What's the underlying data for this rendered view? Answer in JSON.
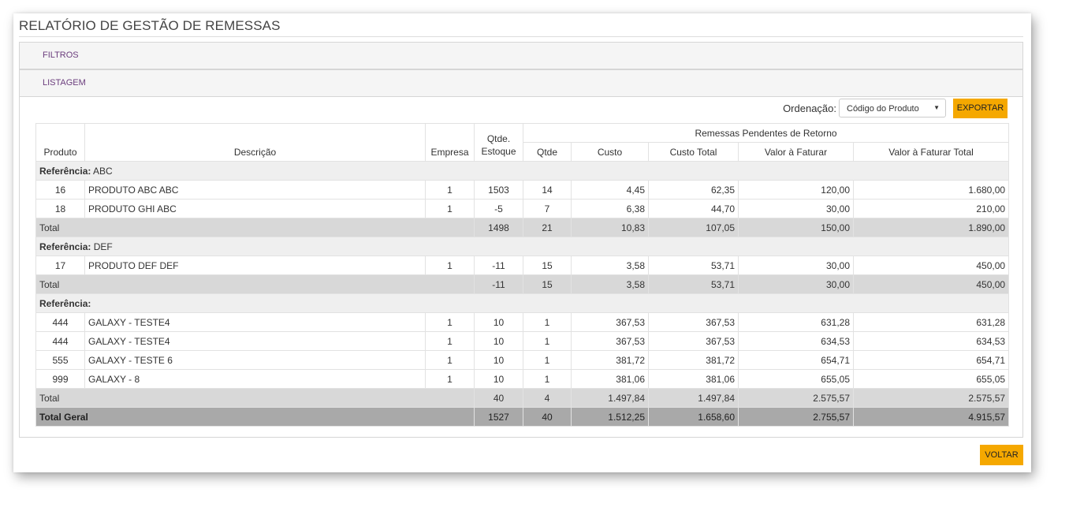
{
  "page": {
    "title": "RELATÓRIO DE GESTÃO DE REMESSAS",
    "filtros_label": "FILTROS",
    "listagem_label": "LISTAGEM",
    "ordenacao_label": "Ordenação:",
    "ordenacao_value": "Código do Produto",
    "export_label": "EXPORTAR",
    "voltar_label": "VOLTAR"
  },
  "table": {
    "headers": {
      "produto": "Produto",
      "descricao": "Descrição",
      "empresa": "Empresa",
      "qtde_estoque_1": "Qtde.",
      "qtde_estoque_2": "Estoque",
      "group": "Remessas Pendentes de Retorno",
      "qtde": "Qtde",
      "custo": "Custo",
      "custo_total": "Custo Total",
      "valor_faturar": "Valor à Faturar",
      "valor_faturar_total": "Valor à Faturar Total"
    },
    "ref_prefix": "Referência:",
    "total_label": "Total",
    "grand_total_label": "Total Geral",
    "groups": [
      {
        "reference": "ABC",
        "rows": [
          {
            "produto": "16",
            "descricao": "PRODUTO ABC ABC",
            "empresa": "1",
            "estoque": "1503",
            "qtde": "14",
            "custo": "4,45",
            "custo_total": "62,35",
            "valor": "120,00",
            "valor_total": "1.680,00"
          },
          {
            "produto": "18",
            "descricao": "PRODUTO GHI ABC",
            "empresa": "1",
            "estoque": "-5",
            "qtde": "7",
            "custo": "6,38",
            "custo_total": "44,70",
            "valor": "30,00",
            "valor_total": "210,00"
          }
        ],
        "total": {
          "estoque": "1498",
          "qtde": "21",
          "custo": "10,83",
          "custo_total": "107,05",
          "valor": "150,00",
          "valor_total": "1.890,00"
        }
      },
      {
        "reference": "DEF",
        "rows": [
          {
            "produto": "17",
            "descricao": "PRODUTO DEF DEF",
            "empresa": "1",
            "estoque": "-11",
            "qtde": "15",
            "custo": "3,58",
            "custo_total": "53,71",
            "valor": "30,00",
            "valor_total": "450,00"
          }
        ],
        "total": {
          "estoque": "-11",
          "qtde": "15",
          "custo": "3,58",
          "custo_total": "53,71",
          "valor": "30,00",
          "valor_total": "450,00"
        }
      },
      {
        "reference": "",
        "rows": [
          {
            "produto": "444",
            "descricao": "GALAXY - TESTE4",
            "empresa": "1",
            "estoque": "10",
            "qtde": "1",
            "custo": "367,53",
            "custo_total": "367,53",
            "valor": "631,28",
            "valor_total": "631,28"
          },
          {
            "produto": "444",
            "descricao": "GALAXY - TESTE4",
            "empresa": "1",
            "estoque": "10",
            "qtde": "1",
            "custo": "367,53",
            "custo_total": "367,53",
            "valor": "634,53",
            "valor_total": "634,53"
          },
          {
            "produto": "555",
            "descricao": "GALAXY - TESTE 6",
            "empresa": "1",
            "estoque": "10",
            "qtde": "1",
            "custo": "381,72",
            "custo_total": "381,72",
            "valor": "654,71",
            "valor_total": "654,71"
          },
          {
            "produto": "999",
            "descricao": "GALAXY - 8",
            "empresa": "1",
            "estoque": "10",
            "qtde": "1",
            "custo": "381,06",
            "custo_total": "381,06",
            "valor": "655,05",
            "valor_total": "655,05"
          }
        ],
        "total": {
          "estoque": "40",
          "qtde": "4",
          "custo": "1.497,84",
          "custo_total": "1.497,84",
          "valor": "2.575,57",
          "valor_total": "2.575,57"
        }
      }
    ],
    "grand_total": {
      "estoque": "1527",
      "qtde": "40",
      "custo": "1.512,25",
      "custo_total": "1.658,60",
      "valor": "2.755,57",
      "valor_total": "4.915,57"
    }
  }
}
